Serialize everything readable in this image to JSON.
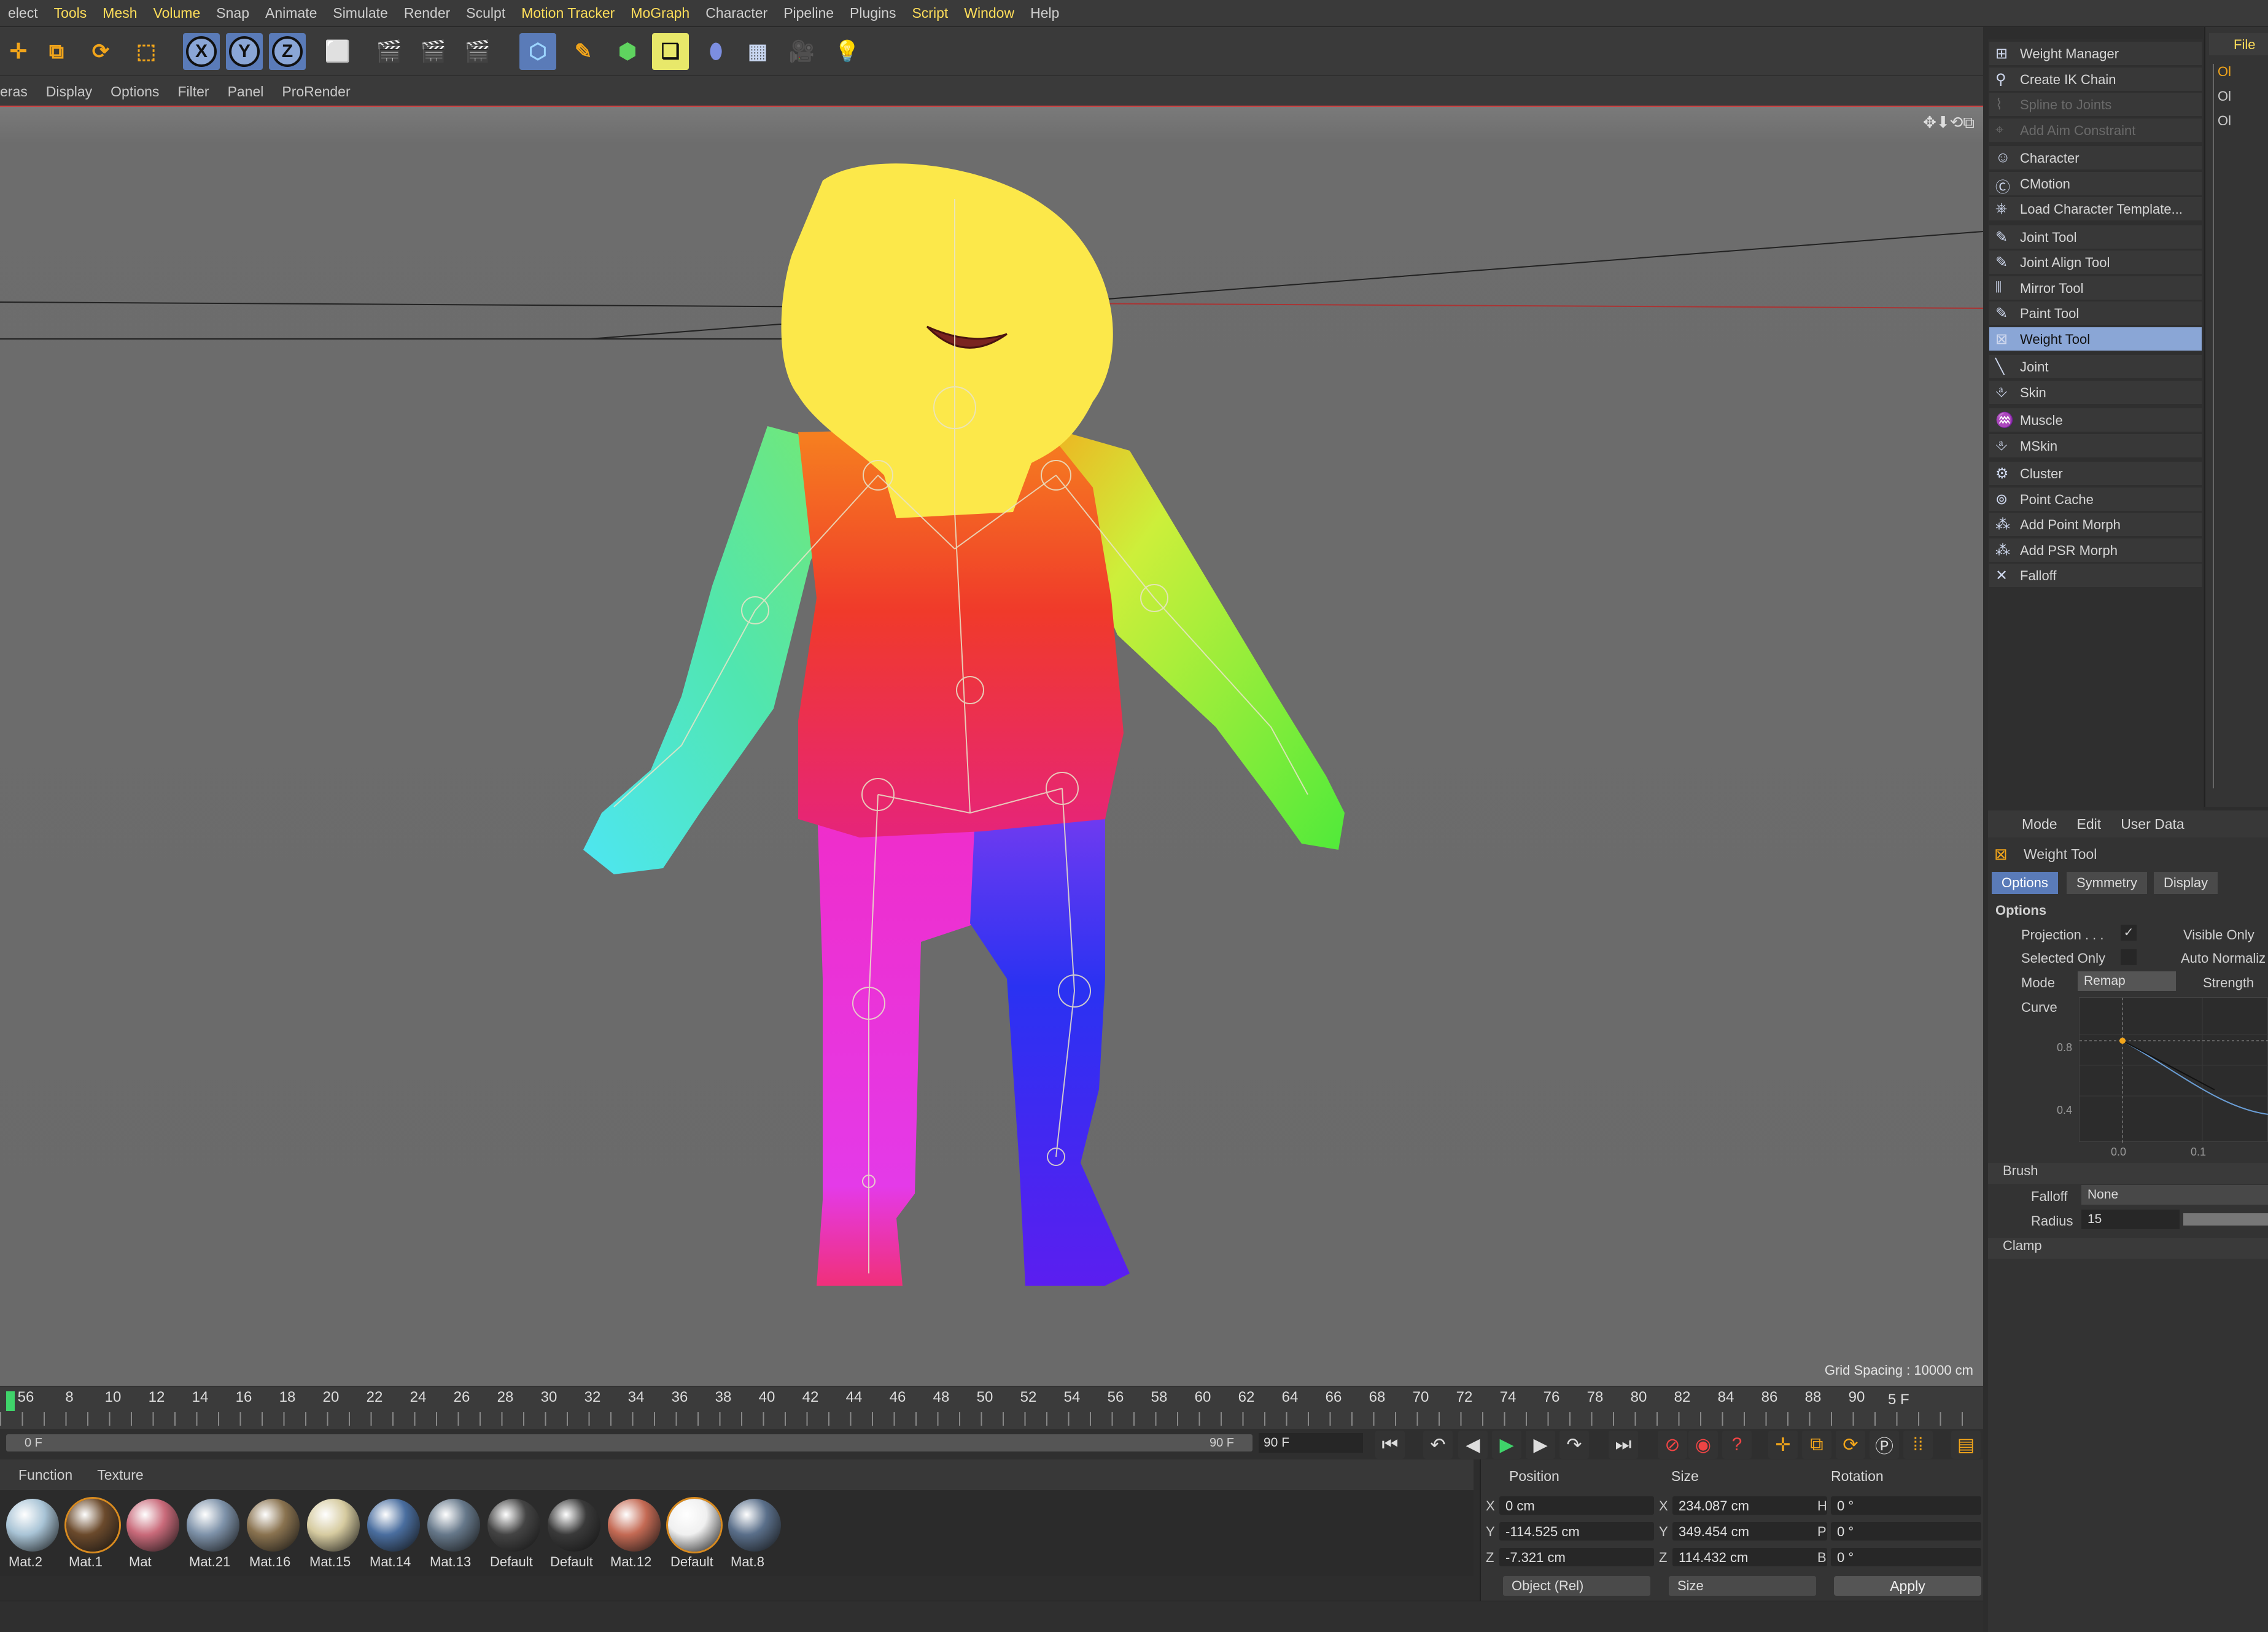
{
  "menubar": {
    "items": [
      "elect",
      "Tools",
      "Mesh",
      "Volume",
      "Snap",
      "Animate",
      "Simulate",
      "Render",
      "Sculpt",
      "Motion Tracker",
      "MoGraph",
      "Character",
      "Pipeline",
      "Plugins",
      "Script",
      "Window",
      "Help"
    ],
    "highlighted": [
      "Tools",
      "Mesh",
      "Volume",
      "Motion Tracker",
      "MoGraph",
      "Script",
      "Window"
    ]
  },
  "toolbar": {
    "axis_x": "X",
    "axis_y": "Y",
    "axis_z": "Z",
    "icons": [
      "move-icon",
      "scale-icon",
      "rotate-icon",
      "live-selection-icon",
      "coordinate-system-icon",
      "render-view-icon",
      "render-picture-queue-icon",
      "render-settings-icon",
      "cube-icon",
      "pen-icon",
      "subdivision-icon",
      "array-icon",
      "deformer-icon",
      "floor-icon",
      "camera-icon",
      "light-icon"
    ]
  },
  "viewport_menu": [
    "eras",
    "Display",
    "Options",
    "Filter",
    "Panel",
    "ProRender"
  ],
  "viewport": {
    "grid_spacing": "Grid Spacing : 10000 cm"
  },
  "timeline": {
    "ticks": [
      "56",
      "8",
      "10",
      "12",
      "14",
      "16",
      "18",
      "20",
      "22",
      "24",
      "26",
      "28",
      "30",
      "32",
      "34",
      "36",
      "38",
      "40",
      "42",
      "44",
      "46",
      "48",
      "50",
      "52",
      "54",
      "56",
      "58",
      "60",
      "62",
      "64",
      "66",
      "68",
      "70",
      "72",
      "74",
      "76",
      "78",
      "80",
      "82",
      "84",
      "86",
      "88",
      "90"
    ],
    "current": "5 F",
    "range_start": "0 F",
    "range_end": "90 F",
    "end_field": "90 F"
  },
  "materials": {
    "menu": [
      "Function",
      "Texture"
    ],
    "items": [
      {
        "name": "Mat.2",
        "color": "#a9c4d6"
      },
      {
        "name": "Mat.1",
        "color": "#6b4a2c"
      },
      {
        "name": "Mat",
        "color": "#c96a7a"
      },
      {
        "name": "Mat.21",
        "color": "#7e92a9"
      },
      {
        "name": "Mat.16",
        "color": "#8a7350"
      },
      {
        "name": "Mat.15",
        "color": "#d6cba0"
      },
      {
        "name": "Mat.14",
        "color": "#4a6e9f"
      },
      {
        "name": "Mat.13",
        "color": "#66788a"
      },
      {
        "name": "Default",
        "color": "#444"
      },
      {
        "name": "Default",
        "color": "#3a3a3a"
      },
      {
        "name": "Mat.12",
        "color": "#c46a54"
      },
      {
        "name": "Default",
        "color": "#f0f0f0"
      },
      {
        "name": "Mat.8",
        "color": "#5a6f8a"
      }
    ]
  },
  "coords": {
    "headers": {
      "position": "Position",
      "size": "Size",
      "rotation": "Rotation"
    },
    "rows": [
      {
        "axis": "X",
        "pos": "0 cm",
        "saxis": "X",
        "size": "234.087 cm",
        "raxis": "H",
        "rot": "0 °"
      },
      {
        "axis": "Y",
        "pos": "-114.525 cm",
        "saxis": "Y",
        "size": "349.454 cm",
        "raxis": "P",
        "rot": "0 °"
      },
      {
        "axis": "Z",
        "pos": "-7.321 cm",
        "saxis": "Z",
        "size": "114.432 cm",
        "raxis": "B",
        "rot": "0 °"
      }
    ],
    "mode": "Object (Rel)",
    "size_mode": "Size",
    "apply": "Apply"
  },
  "character_menu": {
    "items": [
      {
        "label": "Weight Manager",
        "state": "normal"
      },
      {
        "label": "Create IK Chain",
        "state": "normal"
      },
      {
        "label": "Spline to Joints",
        "state": "disabled"
      },
      {
        "label": "Add Aim Constraint",
        "state": "disabled"
      },
      {
        "label": "Character",
        "state": "normal"
      },
      {
        "label": "CMotion",
        "state": "normal"
      },
      {
        "label": "Load Character Template...",
        "state": "normal"
      },
      {
        "label": "Joint Tool",
        "state": "normal"
      },
      {
        "label": "Joint Align Tool",
        "state": "normal"
      },
      {
        "label": "Mirror Tool",
        "state": "normal"
      },
      {
        "label": "Paint Tool",
        "state": "normal"
      },
      {
        "label": "Weight Tool",
        "state": "selected"
      },
      {
        "label": "Joint",
        "state": "normal"
      },
      {
        "label": "Skin",
        "state": "normal"
      },
      {
        "label": "Muscle",
        "state": "normal"
      },
      {
        "label": "MSkin",
        "state": "normal"
      },
      {
        "label": "Cluster",
        "state": "normal"
      },
      {
        "label": "Point Cache",
        "state": "normal"
      },
      {
        "label": "Add Point Morph",
        "state": "normal"
      },
      {
        "label": "Add PSR Morph",
        "state": "normal"
      },
      {
        "label": "Falloff",
        "state": "normal"
      }
    ]
  },
  "object_manager": {
    "menu": "File",
    "objects": [
      "Ol",
      "Ol",
      "Ol"
    ]
  },
  "attributes": {
    "menu": [
      "Mode",
      "Edit",
      "User Data"
    ],
    "title": "Weight Tool",
    "tabs": [
      "Options",
      "Symmetry",
      "Display"
    ],
    "section": "Options",
    "projection_label": "Projection . . .",
    "projection_mark": "✓",
    "visible_only": "Visible Only",
    "selected_only": "Selected Only",
    "auto_normalize": "Auto Normaliz",
    "mode_label": "Mode",
    "mode_value": "Remap",
    "strength_label": "Strength",
    "curve_label": "Curve",
    "curve_ticks": {
      "y": [
        "0.8",
        "0.4"
      ],
      "x": [
        "0.0",
        "0.1"
      ]
    },
    "brush": "Brush",
    "falloff_label": "Falloff",
    "falloff_value": "None",
    "radius_label": "Radius",
    "radius_value": "15",
    "clamp": "Clamp"
  },
  "colors": {
    "accent": "#5a7bb8",
    "highlight_menu": "#ffde5a",
    "selected_item": "#8aa6d6",
    "active_frame": "#3fd36a"
  }
}
